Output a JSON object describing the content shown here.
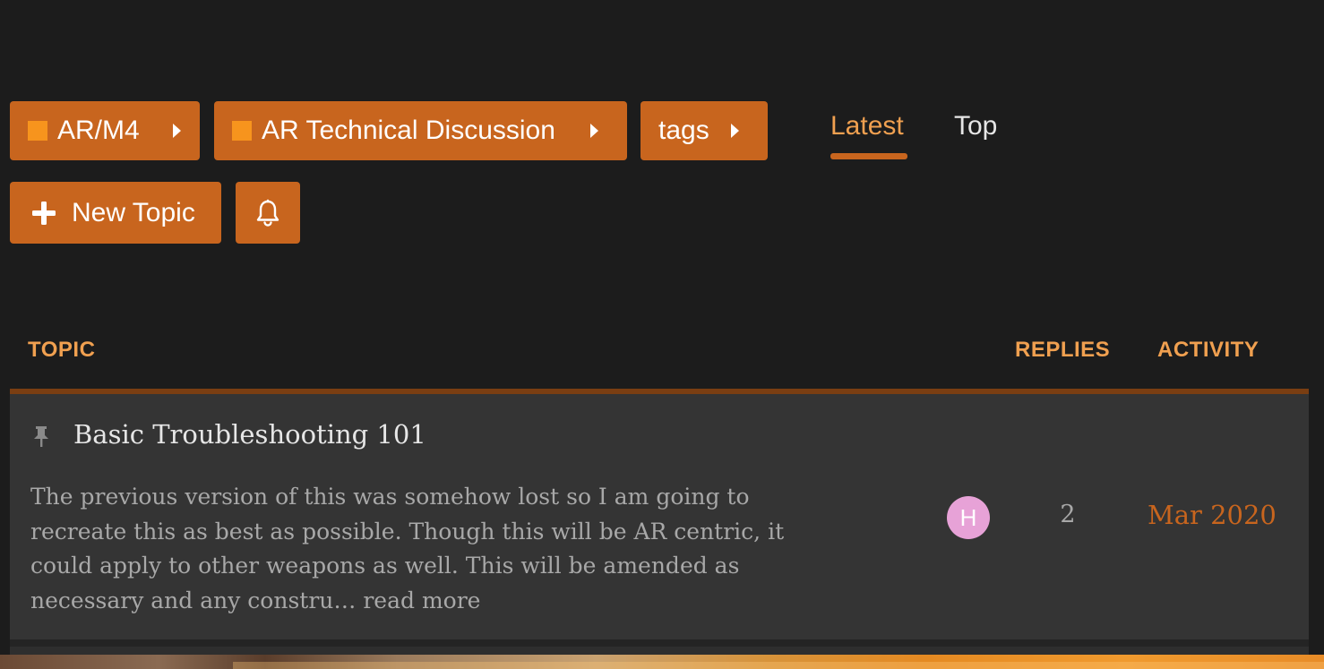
{
  "breadcrumbs": [
    {
      "label": "AR/M4",
      "has_swatch": true
    },
    {
      "label": "AR Technical Discussion",
      "has_swatch": true
    },
    {
      "label": "tags",
      "has_swatch": false
    }
  ],
  "nav": {
    "tabs": [
      {
        "label": "Latest",
        "active": true
      },
      {
        "label": "Top",
        "active": false
      }
    ]
  },
  "actions": {
    "new_topic_label": "New Topic",
    "new_topic_icon": "plus-icon",
    "notifications_icon": "bell-icon"
  },
  "table": {
    "columns": {
      "topic": "TOPIC",
      "replies": "REPLIES",
      "activity": "ACTIVITY"
    },
    "rows": [
      {
        "pinned": true,
        "title": "Basic Troubleshooting 101",
        "excerpt": "The previous version of this was somehow lost so I am going to recreate this as best as possible. Though this will be AR centric, it could apply to other weapons as well. This will be amended as necessary and any constru… ",
        "read_more": "read more",
        "poster_initial": "H",
        "replies": "2",
        "activity": "Mar 2020"
      }
    ]
  },
  "colors": {
    "accent": "#c8651e",
    "category_swatch": "#f7941d",
    "header_text": "#f0a050",
    "background": "#1c1c1c",
    "row_background": "#343434",
    "avatar": "#e7a2d7"
  }
}
